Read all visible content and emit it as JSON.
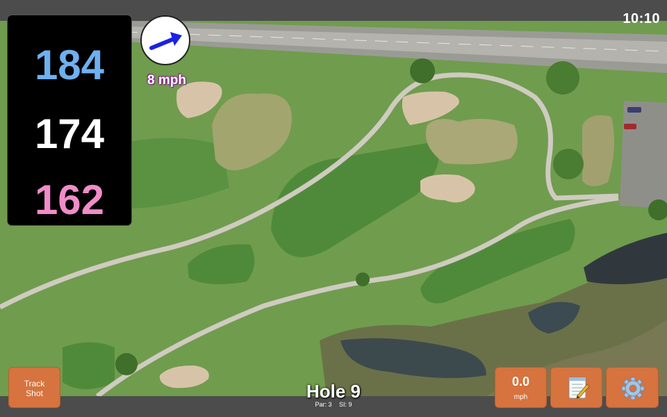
{
  "status": {
    "time": "10:10"
  },
  "yardages": {
    "back": "184",
    "middle": "174",
    "front": "162"
  },
  "wind": {
    "speed_label": "8 mph",
    "direction_icon": "arrow-icon"
  },
  "buttons": {
    "track_shot": "Track\nShot",
    "speed_value": "0.0",
    "speed_unit": "mph",
    "notes_icon": "notepad-icon",
    "settings_icon": "gear-icon"
  },
  "hole": {
    "title": "Hole 9",
    "par": "Par: 3",
    "si": "SI: 9"
  },
  "colors": {
    "back": "#6fb0f0",
    "middle": "#ffffff",
    "front": "#f08cc8",
    "button": "#d6733e",
    "grass": "#6f9a4e"
  }
}
